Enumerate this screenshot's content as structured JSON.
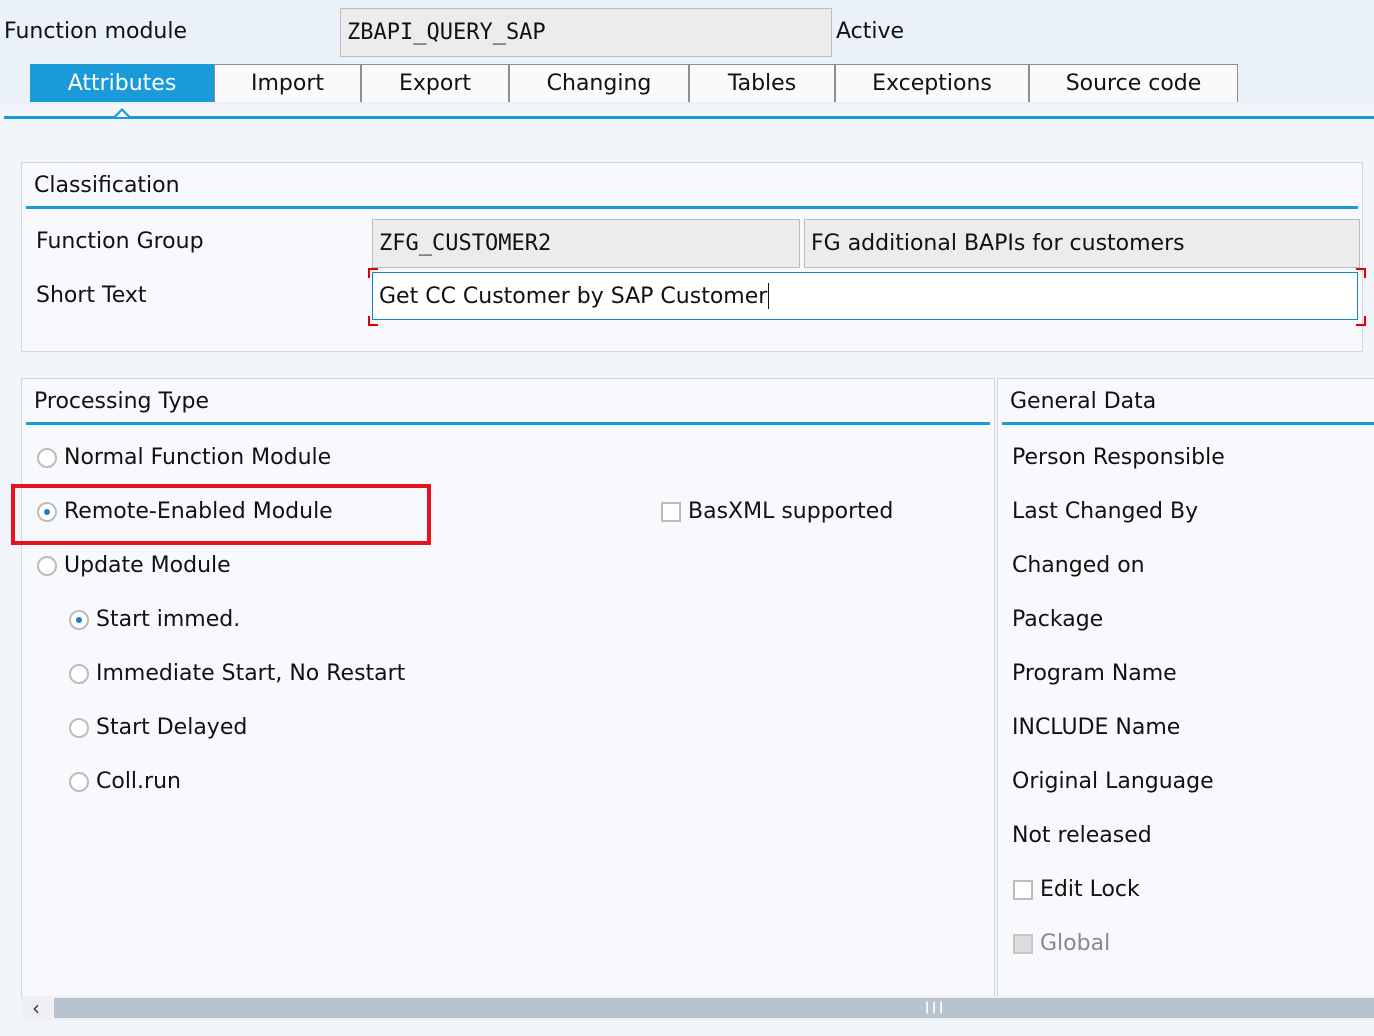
{
  "header": {
    "label": "Function module",
    "name": "ZBAPI_QUERY_SAP",
    "status": "Active"
  },
  "tabs": [
    "Attributes",
    "Import",
    "Export",
    "Changing",
    "Tables",
    "Exceptions",
    "Source code"
  ],
  "classification": {
    "title": "Classification",
    "function_group_label": "Function Group",
    "function_group_value": "ZFG_CUSTOMER2",
    "function_group_desc": "FG additional BAPIs for customers",
    "short_text_label": "Short Text",
    "short_text_value": "Get CC Customer by SAP Customer"
  },
  "processing_type": {
    "title": "Processing Type",
    "normal": "Normal Function Module",
    "remote": "Remote-Enabled Module",
    "basxml": "BasXML supported",
    "update": "Update Module",
    "start_immed": "Start immed.",
    "immediate_no_restart": "Immediate Start, No Restart",
    "start_delayed": "Start Delayed",
    "coll_run": "Coll.run"
  },
  "general_data": {
    "title": "General Data",
    "person_responsible": "Person Responsible",
    "last_changed_by": "Last Changed By",
    "changed_on": "Changed on",
    "package": "Package",
    "program_name": "Program Name",
    "include_name": "INCLUDE Name",
    "original_language": "Original Language",
    "not_released": "Not released",
    "edit_lock": "Edit Lock",
    "global": "Global"
  },
  "colors": {
    "accent": "#1a9ad8",
    "highlight": "#e8121f"
  },
  "icons": {
    "scroll_left": "chevron-left-icon",
    "scroll_grip": "grip-icon"
  }
}
